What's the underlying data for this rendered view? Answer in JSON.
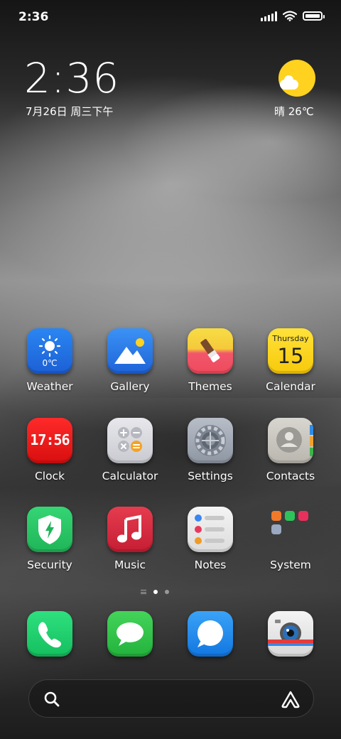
{
  "status_bar": {
    "time": "2:36"
  },
  "clock_widget": {
    "time": "2:36",
    "date": "7月26日 周三下午"
  },
  "weather_widget": {
    "text": "晴 26℃"
  },
  "apps": {
    "weather": {
      "label": "Weather",
      "temp": "0℃"
    },
    "gallery": {
      "label": "Gallery"
    },
    "themes": {
      "label": "Themes"
    },
    "calendar": {
      "label": "Calendar",
      "day_name": "Thursday",
      "day_number": "15"
    },
    "clock": {
      "label": "Clock",
      "display": "17:56"
    },
    "calculator": {
      "label": "Calculator"
    },
    "settings": {
      "label": "Settings"
    },
    "contacts": {
      "label": "Contacts"
    },
    "security": {
      "label": "Security"
    },
    "music": {
      "label": "Music"
    },
    "notes": {
      "label": "Notes"
    },
    "system": {
      "label": "System"
    }
  },
  "dock": {
    "apps": [
      "phone",
      "messages",
      "browser",
      "camera"
    ]
  },
  "colors": {
    "weather_blue": "#1f6fe0",
    "gallery_blue": "#2a7de8",
    "themes_yellow": "#f8d640",
    "themes_red": "#f25060",
    "calendar_yellow": "#ffd81a",
    "clock_red": "#ee1111",
    "security_green": "#2ac96a",
    "music_red": "#d72a3e",
    "phone_green": "#1fd16f",
    "browser_blue": "#1d8ef0",
    "weather_sun": "#ffd21f"
  },
  "page_indicator": {
    "count": 2,
    "active": 1
  }
}
